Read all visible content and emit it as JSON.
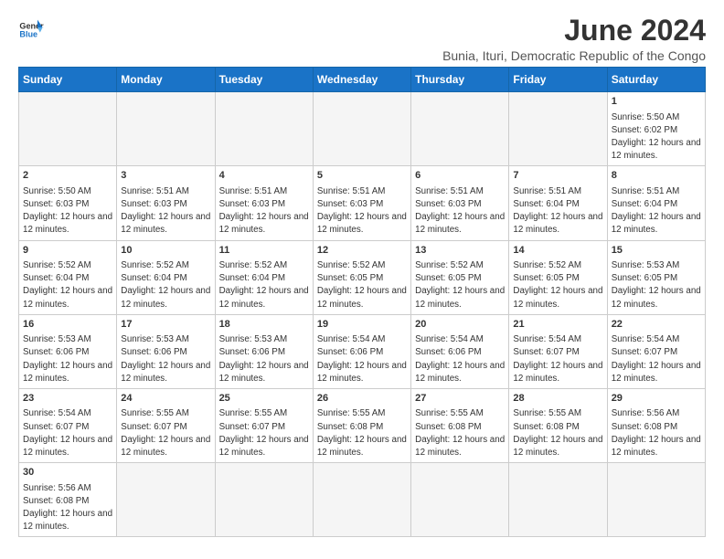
{
  "header": {
    "logo_general": "General",
    "logo_blue": "Blue",
    "main_title": "June 2024",
    "subtitle": "Bunia, Ituri, Democratic Republic of the Congo"
  },
  "weekdays": [
    "Sunday",
    "Monday",
    "Tuesday",
    "Wednesday",
    "Thursday",
    "Friday",
    "Saturday"
  ],
  "weeks": [
    [
      {
        "day": "",
        "empty": true
      },
      {
        "day": "",
        "empty": true
      },
      {
        "day": "",
        "empty": true
      },
      {
        "day": "",
        "empty": true
      },
      {
        "day": "",
        "empty": true
      },
      {
        "day": "",
        "empty": true
      },
      {
        "day": "1",
        "sunrise": "5:50 AM",
        "sunset": "6:02 PM",
        "daylight": "12 hours and 12 minutes."
      }
    ],
    [
      {
        "day": "2",
        "sunrise": "5:50 AM",
        "sunset": "6:03 PM",
        "daylight": "12 hours and 12 minutes."
      },
      {
        "day": "3",
        "sunrise": "5:51 AM",
        "sunset": "6:03 PM",
        "daylight": "12 hours and 12 minutes."
      },
      {
        "day": "4",
        "sunrise": "5:51 AM",
        "sunset": "6:03 PM",
        "daylight": "12 hours and 12 minutes."
      },
      {
        "day": "5",
        "sunrise": "5:51 AM",
        "sunset": "6:03 PM",
        "daylight": "12 hours and 12 minutes."
      },
      {
        "day": "6",
        "sunrise": "5:51 AM",
        "sunset": "6:03 PM",
        "daylight": "12 hours and 12 minutes."
      },
      {
        "day": "7",
        "sunrise": "5:51 AM",
        "sunset": "6:04 PM",
        "daylight": "12 hours and 12 minutes."
      },
      {
        "day": "8",
        "sunrise": "5:51 AM",
        "sunset": "6:04 PM",
        "daylight": "12 hours and 12 minutes."
      }
    ],
    [
      {
        "day": "9",
        "sunrise": "5:52 AM",
        "sunset": "6:04 PM",
        "daylight": "12 hours and 12 minutes."
      },
      {
        "day": "10",
        "sunrise": "5:52 AM",
        "sunset": "6:04 PM",
        "daylight": "12 hours and 12 minutes."
      },
      {
        "day": "11",
        "sunrise": "5:52 AM",
        "sunset": "6:04 PM",
        "daylight": "12 hours and 12 minutes."
      },
      {
        "day": "12",
        "sunrise": "5:52 AM",
        "sunset": "6:05 PM",
        "daylight": "12 hours and 12 minutes."
      },
      {
        "day": "13",
        "sunrise": "5:52 AM",
        "sunset": "6:05 PM",
        "daylight": "12 hours and 12 minutes."
      },
      {
        "day": "14",
        "sunrise": "5:52 AM",
        "sunset": "6:05 PM",
        "daylight": "12 hours and 12 minutes."
      },
      {
        "day": "15",
        "sunrise": "5:53 AM",
        "sunset": "6:05 PM",
        "daylight": "12 hours and 12 minutes."
      }
    ],
    [
      {
        "day": "16",
        "sunrise": "5:53 AM",
        "sunset": "6:06 PM",
        "daylight": "12 hours and 12 minutes."
      },
      {
        "day": "17",
        "sunrise": "5:53 AM",
        "sunset": "6:06 PM",
        "daylight": "12 hours and 12 minutes."
      },
      {
        "day": "18",
        "sunrise": "5:53 AM",
        "sunset": "6:06 PM",
        "daylight": "12 hours and 12 minutes."
      },
      {
        "day": "19",
        "sunrise": "5:54 AM",
        "sunset": "6:06 PM",
        "daylight": "12 hours and 12 minutes."
      },
      {
        "day": "20",
        "sunrise": "5:54 AM",
        "sunset": "6:06 PM",
        "daylight": "12 hours and 12 minutes."
      },
      {
        "day": "21",
        "sunrise": "5:54 AM",
        "sunset": "6:07 PM",
        "daylight": "12 hours and 12 minutes."
      },
      {
        "day": "22",
        "sunrise": "5:54 AM",
        "sunset": "6:07 PM",
        "daylight": "12 hours and 12 minutes."
      }
    ],
    [
      {
        "day": "23",
        "sunrise": "5:54 AM",
        "sunset": "6:07 PM",
        "daylight": "12 hours and 12 minutes."
      },
      {
        "day": "24",
        "sunrise": "5:55 AM",
        "sunset": "6:07 PM",
        "daylight": "12 hours and 12 minutes."
      },
      {
        "day": "25",
        "sunrise": "5:55 AM",
        "sunset": "6:07 PM",
        "daylight": "12 hours and 12 minutes."
      },
      {
        "day": "26",
        "sunrise": "5:55 AM",
        "sunset": "6:08 PM",
        "daylight": "12 hours and 12 minutes."
      },
      {
        "day": "27",
        "sunrise": "5:55 AM",
        "sunset": "6:08 PM",
        "daylight": "12 hours and 12 minutes."
      },
      {
        "day": "28",
        "sunrise": "5:55 AM",
        "sunset": "6:08 PM",
        "daylight": "12 hours and 12 minutes."
      },
      {
        "day": "29",
        "sunrise": "5:56 AM",
        "sunset": "6:08 PM",
        "daylight": "12 hours and 12 minutes."
      }
    ],
    [
      {
        "day": "30",
        "sunrise": "5:56 AM",
        "sunset": "6:08 PM",
        "daylight": "12 hours and 12 minutes."
      },
      {
        "day": "",
        "empty": true
      },
      {
        "day": "",
        "empty": true
      },
      {
        "day": "",
        "empty": true
      },
      {
        "day": "",
        "empty": true
      },
      {
        "day": "",
        "empty": true
      },
      {
        "day": "",
        "empty": true
      }
    ]
  ],
  "labels": {
    "sunrise": "Sunrise: ",
    "sunset": "Sunset: ",
    "daylight": "Daylight: "
  }
}
